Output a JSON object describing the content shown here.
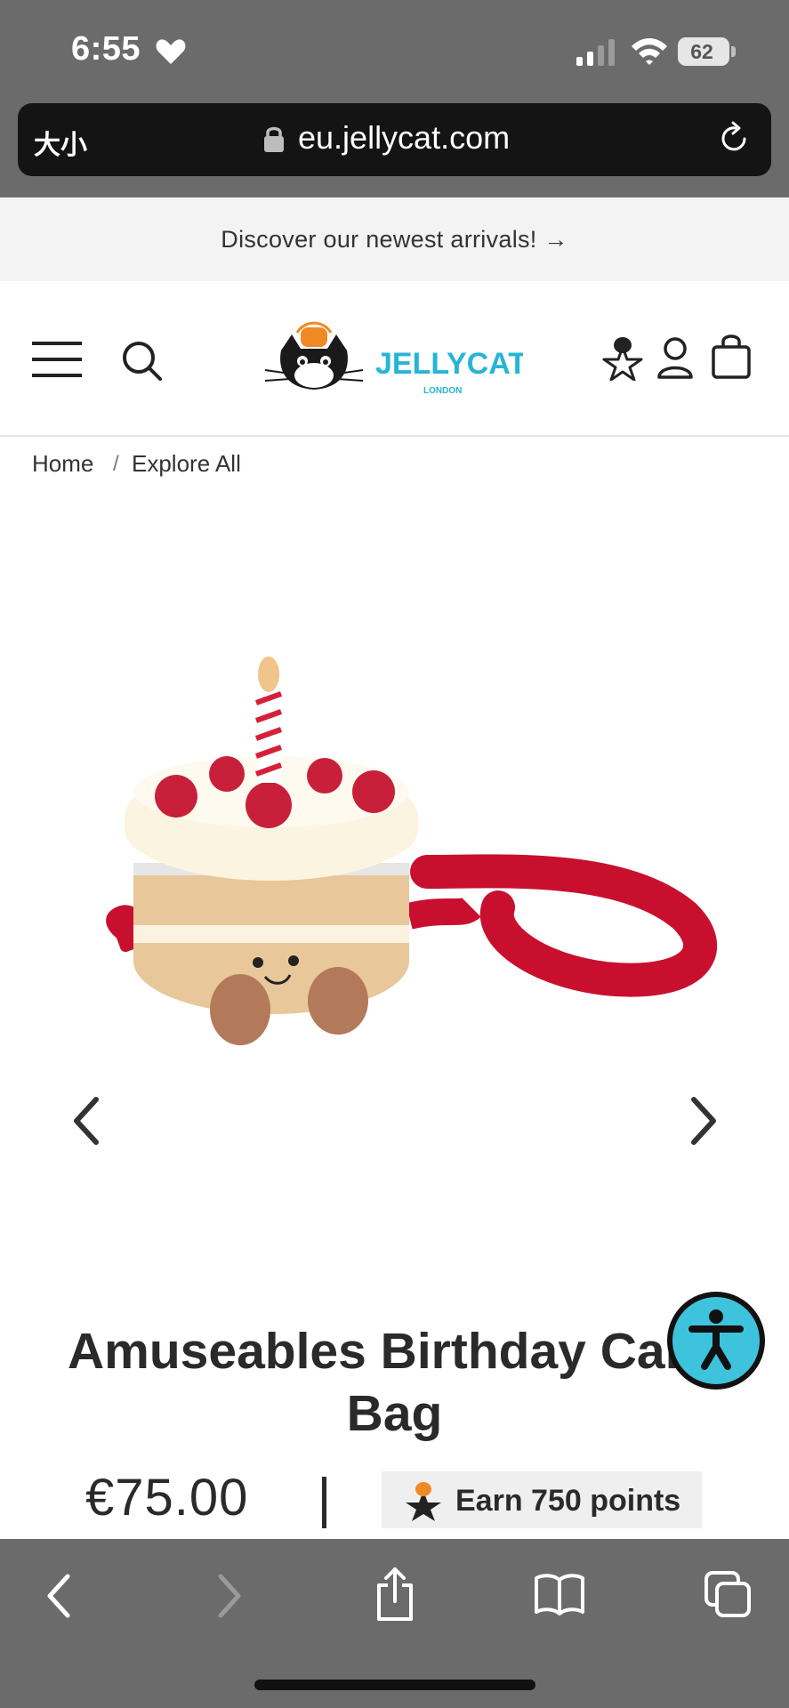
{
  "status_bar": {
    "time": "6:55",
    "battery": "62"
  },
  "browser": {
    "text_size_label": "大小",
    "url": "eu.jellycat.com"
  },
  "promo_banner": {
    "text": "Discover our newest arrivals! →"
  },
  "header": {
    "logo_text": "JELLYCAT",
    "logo_subtext": "LONDON"
  },
  "breadcrumb": {
    "home": "Home",
    "separator": "/",
    "current": "Explore All"
  },
  "product": {
    "title": "Amuseables Birthday Cake\nBag",
    "price": "€75.00",
    "points": "Earn 750 points"
  },
  "colors": {
    "accent": "#3ec3dd",
    "strap_red": "#c8102e",
    "chrome_gray": "#6b6b6b"
  }
}
